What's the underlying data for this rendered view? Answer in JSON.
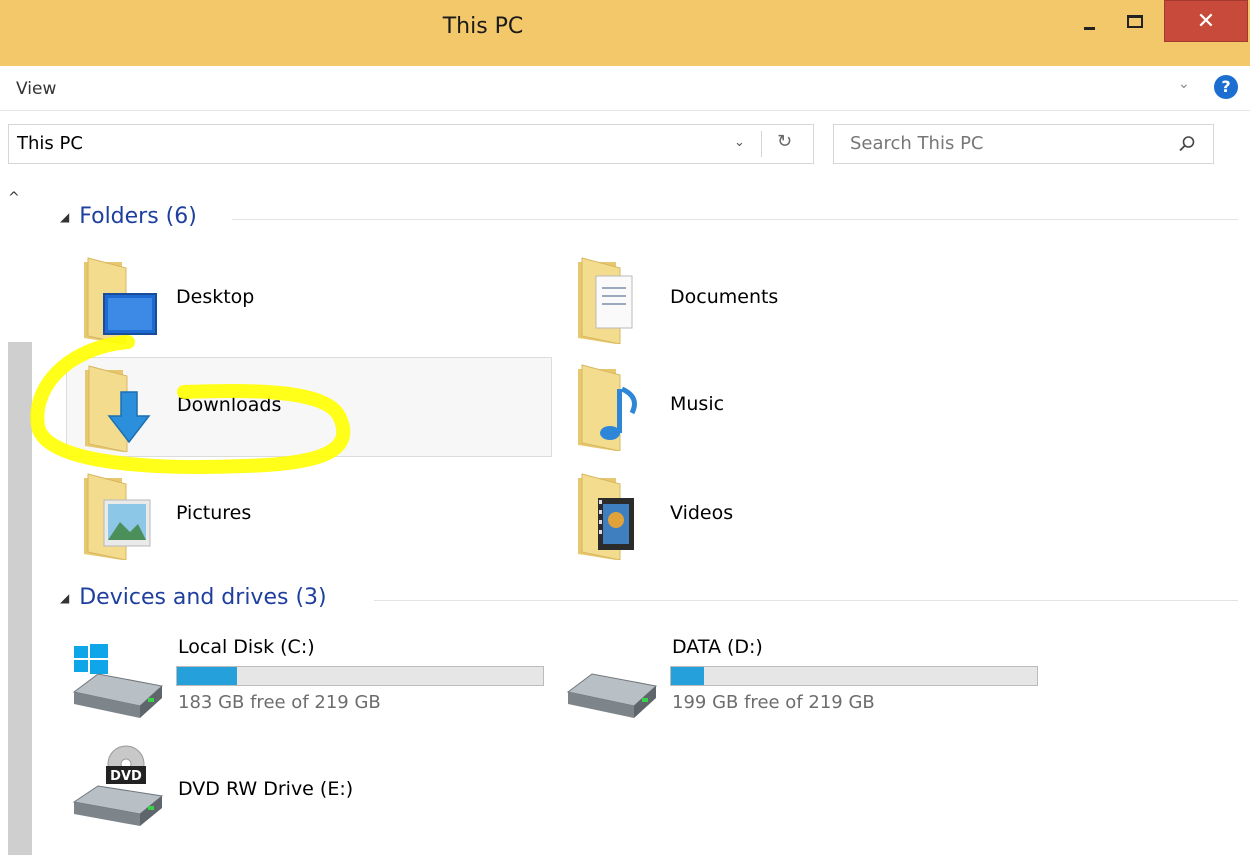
{
  "window": {
    "title": "This PC"
  },
  "ribbon": {
    "view_tab": "View"
  },
  "address": {
    "path": "This PC"
  },
  "search": {
    "placeholder": "Search This PC"
  },
  "sections": {
    "folders": {
      "header": "Folders (6)"
    },
    "devices": {
      "header": "Devices and drives (3)"
    }
  },
  "folders": [
    {
      "label": "Desktop",
      "icon": "desktop-folder-icon"
    },
    {
      "label": "Documents",
      "icon": "documents-folder-icon"
    },
    {
      "label": "Downloads",
      "icon": "downloads-folder-icon"
    },
    {
      "label": "Music",
      "icon": "music-folder-icon"
    },
    {
      "label": "Pictures",
      "icon": "pictures-folder-icon"
    },
    {
      "label": "Videos",
      "icon": "videos-folder-icon"
    }
  ],
  "drives": [
    {
      "name": "Local Disk (C:)",
      "free_text": "183 GB free of 219 GB",
      "used_fraction": 0.164,
      "icon": "windows-drive-icon"
    },
    {
      "name": "DATA (D:)",
      "free_text": "199 GB free of 219 GB",
      "used_fraction": 0.091,
      "icon": "hard-drive-icon"
    },
    {
      "name": "DVD RW Drive (E:)",
      "icon": "dvd-drive-icon"
    }
  ],
  "colors": {
    "titlebar": "#f2c86a",
    "close_button": "#c74a3a",
    "section_header": "#1e3f9e",
    "drive_bar_fill": "#26a0da",
    "highlight": "#ffff00"
  }
}
